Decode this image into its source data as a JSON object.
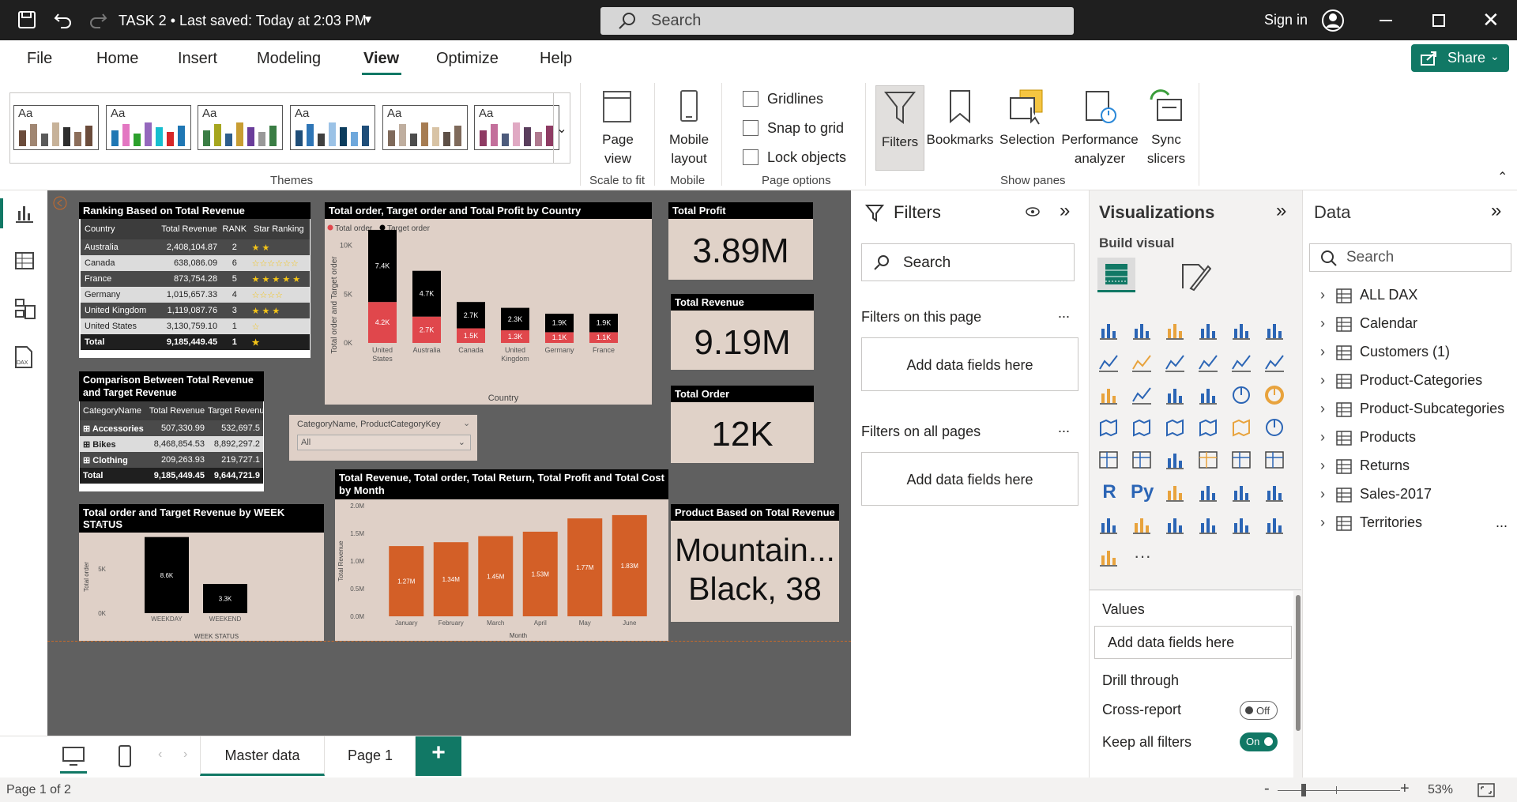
{
  "titlebar": {
    "title": "TASK 2 • Last saved: Today at 2:03 PM",
    "search_placeholder": "Search",
    "sign_in": "Sign in"
  },
  "menu": {
    "items": [
      "File",
      "Home",
      "Insert",
      "Modeling",
      "View",
      "Optimize",
      "Help"
    ],
    "active": "View",
    "share": "Share"
  },
  "ribbon": {
    "theme_label": "Aa",
    "themes_group": "Themes",
    "page_view": [
      "Page",
      "view"
    ],
    "scale_to_fit": "Scale to fit",
    "mobile_layout": [
      "Mobile",
      "layout"
    ],
    "mobile_group": "Mobile",
    "gridlines": "Gridlines",
    "snap_to_grid": "Snap to grid",
    "lock_objects": "Lock objects",
    "page_options": "Page options",
    "filters": "Filters",
    "bookmarks": "Bookmarks",
    "selection": "Selection",
    "performance": [
      "Performance",
      "analyzer"
    ],
    "sync": [
      "Sync",
      "slicers"
    ],
    "show_panes": "Show panes"
  },
  "report": {
    "ranking": {
      "title": "Ranking Based on Total Revenue",
      "headers": [
        "Country",
        "Total Revenue",
        "RANK",
        "Star Ranking"
      ],
      "rows": [
        [
          "Australia",
          "2,408,104.87",
          "2",
          "★ ★"
        ],
        [
          "Canada",
          "638,086.09",
          "6",
          "☆☆☆☆☆☆"
        ],
        [
          "France",
          "873,754.28",
          "5",
          "★ ★ ★ ★ ★"
        ],
        [
          "Germany",
          "1,015,657.33",
          "4",
          "☆☆☆☆"
        ],
        [
          "United Kingdom",
          "1,119,087.76",
          "3",
          "★ ★ ★"
        ],
        [
          "United States",
          "3,130,759.10",
          "1",
          "☆"
        ],
        [
          "Total",
          "9,185,449.45",
          "1",
          "★"
        ]
      ]
    },
    "comparison": {
      "title": "Comparison Between Total Revenue and Target Revenue",
      "headers": [
        "CategoryName",
        "Total Revenue",
        "Target Revenue"
      ],
      "rows": [
        [
          "⊞ Accessories",
          "507,330.99",
          "532,697.5"
        ],
        [
          "⊞ Bikes",
          "8,468,854.53",
          "8,892,297.2"
        ],
        [
          "⊞ Clothing",
          "209,263.93",
          "219,727.1"
        ],
        [
          "Total",
          "9,185,449.45",
          "9,644,721.9"
        ]
      ]
    },
    "country_chart": {
      "title": "Total order, Target order and Total Profit by Country",
      "legend": [
        "Total order",
        "Target order"
      ],
      "ylabel": "Total order and Target order",
      "xlabel": "Country",
      "yticks": [
        "10K",
        "5K",
        "0K"
      ]
    },
    "slicer": {
      "title": "CategoryName, ProductCategoryKey",
      "value": "All"
    },
    "week_chart": {
      "title": "Total order and Target Revenue by WEEK STATUS",
      "ylabel": "Total order",
      "xlabel": "WEEK STATUS",
      "yticks": [
        "10K",
        "5K",
        "0K"
      ]
    },
    "month_chart": {
      "title": "Total Revenue, Total order, Total Return, Total Profit and Total Cost by Month",
      "ylabel": "Total Revenue",
      "xlabel": "Month",
      "yticks": [
        "2.0M",
        "1.5M",
        "1.0M",
        "0.5M",
        "0.0M"
      ]
    },
    "cards": {
      "profit_title": "Total Profit",
      "profit": "3.89M",
      "revenue_title": "Total Revenue",
      "revenue": "9.19M",
      "order_title": "Total Order",
      "order": "12K",
      "product_title": "Product Based on Total Revenue",
      "product_line1": "Mountain...",
      "product_line2": "Black, 38"
    }
  },
  "chart_data": [
    {
      "type": "bar",
      "title": "Total order, Target order and Total Profit by Country",
      "xlabel": "Country",
      "ylabel": "Total order and Target order",
      "categories": [
        "United States",
        "Australia",
        "Canada",
        "United Kingdom",
        "Germany",
        "France"
      ],
      "series": [
        {
          "name": "Total order",
          "values": [
            4200,
            2700,
            1500,
            1300,
            1100,
            1100
          ],
          "labels": [
            "4.2K",
            "2.7K",
            "1.5K",
            "1.3K",
            "1.1K",
            "1.1K"
          ],
          "color": "#e0474c"
        },
        {
          "name": "Target order",
          "values": [
            7400,
            4700,
            2700,
            2300,
            1900,
            1900
          ],
          "labels": [
            "7.4K",
            "4.7K",
            "2.7K",
            "2.3K",
            "1.9K",
            "1.9K"
          ],
          "color": "#000000"
        }
      ],
      "ylim": [
        0,
        12000
      ]
    },
    {
      "type": "bar",
      "title": "Total order and Target Revenue by WEEK STATUS",
      "xlabel": "WEEK STATUS",
      "ylabel": "Total order",
      "categories": [
        "WEEKDAY",
        "WEEKEND"
      ],
      "values": [
        8600,
        3300
      ],
      "labels": [
        "8.6K",
        "3.3K"
      ],
      "color": "#000000",
      "ylim": [
        0,
        10000
      ]
    },
    {
      "type": "bar",
      "title": "Total Revenue, Total order, Total Return, Total Profit and Total Cost by Month",
      "xlabel": "Month",
      "ylabel": "Total Revenue",
      "categories": [
        "January",
        "February",
        "March",
        "April",
        "May",
        "June"
      ],
      "values": [
        1270000,
        1340000,
        1450000,
        1530000,
        1770000,
        1830000
      ],
      "labels": [
        "1.27M",
        "1.34M",
        "1.45M",
        "1.53M",
        "1.77M",
        "1.83M"
      ],
      "color": "#d35f27",
      "ylim": [
        0,
        2000000
      ]
    }
  ],
  "pages": {
    "tabs": [
      "Master data",
      "Page 1"
    ],
    "active": "Master data",
    "add": "+"
  },
  "status": {
    "page": "Page 1 of 2",
    "zoom": "53%",
    "minus": "-",
    "plus": "+"
  },
  "filters_pane": {
    "title": "Filters",
    "search": "Search",
    "on_page": "Filters on this page",
    "on_all": "Filters on all pages",
    "add": "Add data fields here",
    "more": "..."
  },
  "viz_pane": {
    "title": "Visualizations",
    "build": "Build visual",
    "values": "Values",
    "add": "Add data fields here",
    "drill": "Drill through",
    "cross": "Cross-report",
    "off": "Off",
    "keep": "Keep all filters",
    "on": "On",
    "r": "R",
    "py": "Py",
    "dots": "···"
  },
  "data_pane": {
    "title": "Data",
    "search": "Search",
    "tables": [
      "ALL DAX",
      "Calendar",
      "Customers (1)",
      "Product-Categories",
      "Product-Subcategories",
      "Products",
      "Returns",
      "Sales-2017",
      "Territories"
    ],
    "more": "..."
  },
  "colors": {
    "accent": "#117865",
    "canvas": "#606060",
    "card": "#e0d2c8",
    "total_order": "#e0474c",
    "month_bars": "#d35f27"
  }
}
